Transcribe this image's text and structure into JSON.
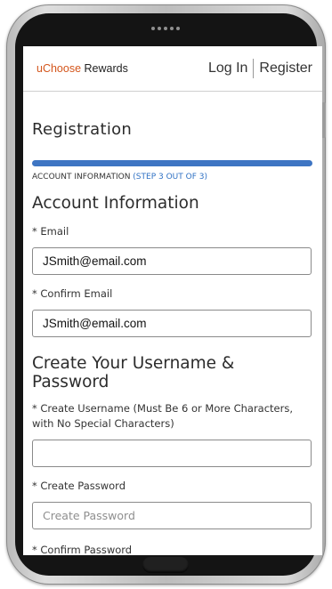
{
  "header": {
    "logo_brand": "uChoose",
    "logo_suffix": " Rewards",
    "login_label": "Log In",
    "register_label": "Register"
  },
  "page": {
    "title": "Registration",
    "progress": {
      "step": 3,
      "total": 3,
      "fraction": 1.0
    },
    "step_text": "ACCOUNT INFORMATION",
    "step_count": "(STEP 3 OUT OF 3)"
  },
  "account": {
    "title": "Account Information",
    "email_label": "* Email",
    "email_value": "JSmith@email.com",
    "confirm_email_label": "* Confirm Email",
    "confirm_email_value": "JSmith@email.com"
  },
  "credentials": {
    "title": "Create Your Username & Password",
    "username_label": "* Create Username (Must Be 6 or More Characters, with No Special Characters)",
    "username_value": "",
    "password_label": "* Create Password",
    "password_placeholder": "Create Password",
    "confirm_password_label": "* Confirm Password"
  },
  "colors": {
    "brand": "#d4561c",
    "accent": "#3e75c3",
    "step_count": "#2f71c4"
  }
}
